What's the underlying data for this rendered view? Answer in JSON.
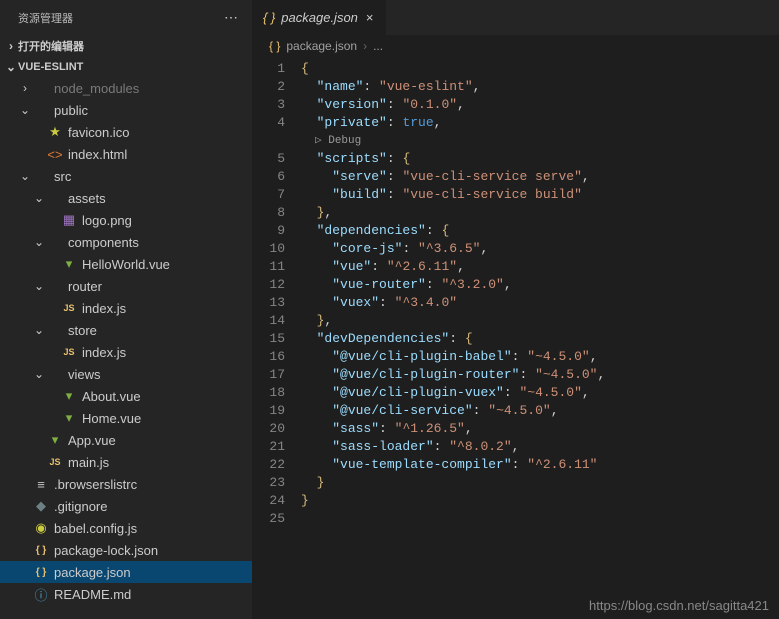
{
  "sidebar": {
    "title": "资源管理器",
    "sections": {
      "opened": "打开的编辑器",
      "project": "VUE-ESLINT"
    },
    "tree": [
      {
        "d": 1,
        "ch": "›",
        "ic": "folder",
        "cl": "muted",
        "label": "node_modules"
      },
      {
        "d": 1,
        "ch": "⌄",
        "ic": "folder",
        "cl": "folder-label",
        "label": "public"
      },
      {
        "d": 2,
        "ch": "",
        "ic": "star",
        "cl": "i-gold",
        "label": "favicon.ico"
      },
      {
        "d": 2,
        "ch": "",
        "ic": "html",
        "cl": "i-orange",
        "label": "index.html"
      },
      {
        "d": 1,
        "ch": "⌄",
        "ic": "folder",
        "cl": "folder-label",
        "label": "src"
      },
      {
        "d": 2,
        "ch": "⌄",
        "ic": "folder",
        "cl": "folder-label",
        "label": "assets"
      },
      {
        "d": 3,
        "ch": "",
        "ic": "img",
        "cl": "i-purple",
        "label": "logo.png"
      },
      {
        "d": 2,
        "ch": "⌄",
        "ic": "folder",
        "cl": "folder-label",
        "label": "components"
      },
      {
        "d": 3,
        "ch": "",
        "ic": "vue",
        "cl": "i-green",
        "label": "HelloWorld.vue"
      },
      {
        "d": 2,
        "ch": "⌄",
        "ic": "folder",
        "cl": "folder-label",
        "label": "router"
      },
      {
        "d": 3,
        "ch": "",
        "ic": "js",
        "cl": "i-yellow",
        "label": "index.js"
      },
      {
        "d": 2,
        "ch": "⌄",
        "ic": "folder",
        "cl": "folder-label",
        "label": "store"
      },
      {
        "d": 3,
        "ch": "",
        "ic": "js",
        "cl": "i-yellow",
        "label": "index.js"
      },
      {
        "d": 2,
        "ch": "⌄",
        "ic": "folder",
        "cl": "folder-label",
        "label": "views"
      },
      {
        "d": 3,
        "ch": "",
        "ic": "vue",
        "cl": "i-green",
        "label": "About.vue"
      },
      {
        "d": 3,
        "ch": "",
        "ic": "vue",
        "cl": "i-green",
        "label": "Home.vue"
      },
      {
        "d": 2,
        "ch": "",
        "ic": "vue",
        "cl": "i-green",
        "label": "App.vue"
      },
      {
        "d": 2,
        "ch": "",
        "ic": "js",
        "cl": "i-yellow",
        "label": "main.js"
      },
      {
        "d": 1,
        "ch": "",
        "ic": "list",
        "cl": "i-white",
        "label": ".browserslistrc"
      },
      {
        "d": 1,
        "ch": "",
        "ic": "git",
        "cl": "i-gray",
        "label": ".gitignore"
      },
      {
        "d": 1,
        "ch": "",
        "ic": "babel",
        "cl": "i-gold",
        "label": "babel.config.js"
      },
      {
        "d": 1,
        "ch": "",
        "ic": "json",
        "cl": "i-yellow",
        "label": "package-lock.json"
      },
      {
        "d": 1,
        "ch": "",
        "ic": "json",
        "cl": "i-yellow",
        "label": "package.json",
        "sel": true
      },
      {
        "d": 1,
        "ch": "",
        "ic": "info",
        "cl": "i-blue",
        "label": "README.md"
      }
    ]
  },
  "tab": {
    "icon": "json",
    "label": "package.json"
  },
  "breadcrumb": {
    "file": "package.json",
    "sep": "›",
    "more": "..."
  },
  "codelens": "▷ Debug",
  "code": {
    "lines": [
      {
        "n": 1,
        "t": [
          [
            "b",
            "{"
          ]
        ]
      },
      {
        "n": 2,
        "t": [
          [
            "p",
            "  "
          ],
          [
            "k",
            "\"name\""
          ],
          [
            "p",
            ": "
          ],
          [
            "s",
            "\"vue-eslint\""
          ],
          [
            "p",
            ","
          ]
        ]
      },
      {
        "n": 3,
        "t": [
          [
            "p",
            "  "
          ],
          [
            "k",
            "\"version\""
          ],
          [
            "p",
            ": "
          ],
          [
            "s",
            "\"0.1.0\""
          ],
          [
            "p",
            ","
          ]
        ]
      },
      {
        "n": 4,
        "t": [
          [
            "p",
            "  "
          ],
          [
            "k",
            "\"private\""
          ],
          [
            "p",
            ": "
          ],
          [
            "c",
            "true"
          ],
          [
            "p",
            ","
          ]
        ]
      },
      {
        "n": 0,
        "codelens": true
      },
      {
        "n": 5,
        "t": [
          [
            "p",
            "  "
          ],
          [
            "k",
            "\"scripts\""
          ],
          [
            "p",
            ": "
          ],
          [
            "b",
            "{"
          ]
        ]
      },
      {
        "n": 6,
        "t": [
          [
            "p",
            "    "
          ],
          [
            "k",
            "\"serve\""
          ],
          [
            "p",
            ": "
          ],
          [
            "s",
            "\"vue-cli-service serve\""
          ],
          [
            "p",
            ","
          ]
        ]
      },
      {
        "n": 7,
        "t": [
          [
            "p",
            "    "
          ],
          [
            "k",
            "\"build\""
          ],
          [
            "p",
            ": "
          ],
          [
            "s",
            "\"vue-cli-service build\""
          ]
        ]
      },
      {
        "n": 8,
        "t": [
          [
            "p",
            "  "
          ],
          [
            "b",
            "}"
          ],
          [
            "p",
            ","
          ]
        ]
      },
      {
        "n": 9,
        "t": [
          [
            "p",
            "  "
          ],
          [
            "k",
            "\"dependencies\""
          ],
          [
            "p",
            ": "
          ],
          [
            "b",
            "{"
          ]
        ]
      },
      {
        "n": 10,
        "t": [
          [
            "p",
            "    "
          ],
          [
            "k",
            "\"core-js\""
          ],
          [
            "p",
            ": "
          ],
          [
            "s",
            "\"^3.6.5\""
          ],
          [
            "p",
            ","
          ]
        ]
      },
      {
        "n": 11,
        "t": [
          [
            "p",
            "    "
          ],
          [
            "k",
            "\"vue\""
          ],
          [
            "p",
            ": "
          ],
          [
            "s",
            "\"^2.6.11\""
          ],
          [
            "p",
            ","
          ]
        ]
      },
      {
        "n": 12,
        "t": [
          [
            "p",
            "    "
          ],
          [
            "k",
            "\"vue-router\""
          ],
          [
            "p",
            ": "
          ],
          [
            "s",
            "\"^3.2.0\""
          ],
          [
            "p",
            ","
          ]
        ]
      },
      {
        "n": 13,
        "t": [
          [
            "p",
            "    "
          ],
          [
            "k",
            "\"vuex\""
          ],
          [
            "p",
            ": "
          ],
          [
            "s",
            "\"^3.4.0\""
          ]
        ]
      },
      {
        "n": 14,
        "t": [
          [
            "p",
            "  "
          ],
          [
            "b",
            "}"
          ],
          [
            "p",
            ","
          ]
        ]
      },
      {
        "n": 15,
        "t": [
          [
            "p",
            "  "
          ],
          [
            "k",
            "\"devDependencies\""
          ],
          [
            "p",
            ": "
          ],
          [
            "b",
            "{"
          ]
        ]
      },
      {
        "n": 16,
        "t": [
          [
            "p",
            "    "
          ],
          [
            "k",
            "\"@vue/cli-plugin-babel\""
          ],
          [
            "p",
            ": "
          ],
          [
            "s",
            "\"~4.5.0\""
          ],
          [
            "p",
            ","
          ]
        ]
      },
      {
        "n": 17,
        "t": [
          [
            "p",
            "    "
          ],
          [
            "k",
            "\"@vue/cli-plugin-router\""
          ],
          [
            "p",
            ": "
          ],
          [
            "s",
            "\"~4.5.0\""
          ],
          [
            "p",
            ","
          ]
        ]
      },
      {
        "n": 18,
        "t": [
          [
            "p",
            "    "
          ],
          [
            "k",
            "\"@vue/cli-plugin-vuex\""
          ],
          [
            "p",
            ": "
          ],
          [
            "s",
            "\"~4.5.0\""
          ],
          [
            "p",
            ","
          ]
        ]
      },
      {
        "n": 19,
        "t": [
          [
            "p",
            "    "
          ],
          [
            "k",
            "\"@vue/cli-service\""
          ],
          [
            "p",
            ": "
          ],
          [
            "s",
            "\"~4.5.0\""
          ],
          [
            "p",
            ","
          ]
        ]
      },
      {
        "n": 20,
        "t": [
          [
            "p",
            "    "
          ],
          [
            "k",
            "\"sass\""
          ],
          [
            "p",
            ": "
          ],
          [
            "s",
            "\"^1.26.5\""
          ],
          [
            "p",
            ","
          ]
        ]
      },
      {
        "n": 21,
        "t": [
          [
            "p",
            "    "
          ],
          [
            "k",
            "\"sass-loader\""
          ],
          [
            "p",
            ": "
          ],
          [
            "s",
            "\"^8.0.2\""
          ],
          [
            "p",
            ","
          ]
        ]
      },
      {
        "n": 22,
        "t": [
          [
            "p",
            "    "
          ],
          [
            "k",
            "\"vue-template-compiler\""
          ],
          [
            "p",
            ": "
          ],
          [
            "s",
            "\"^2.6.11\""
          ]
        ]
      },
      {
        "n": 23,
        "t": [
          [
            "p",
            "  "
          ],
          [
            "b",
            "}"
          ]
        ]
      },
      {
        "n": 24,
        "t": [
          [
            "b",
            "}"
          ]
        ]
      },
      {
        "n": 25,
        "t": [
          [
            "p",
            ""
          ]
        ]
      }
    ]
  },
  "watermark": "https://blog.csdn.net/sagitta421"
}
